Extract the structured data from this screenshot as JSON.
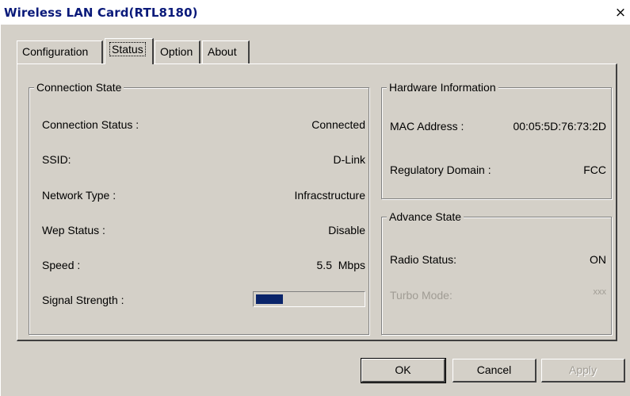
{
  "window": {
    "title": "Wireless LAN Card(RTL8180)",
    "close_glyph": "×"
  },
  "tabs": [
    {
      "label": "Configuration",
      "active": false
    },
    {
      "label": "Status",
      "active": true
    },
    {
      "label": "Option",
      "active": false
    },
    {
      "label": "About",
      "active": false
    }
  ],
  "connection_state": {
    "title": "Connection State",
    "rows": [
      {
        "label": "Connection Status :",
        "value": "Connected"
      },
      {
        "label": "SSID:",
        "value": "D-Link"
      },
      {
        "label": "Network Type :",
        "value": "Infracstructure"
      },
      {
        "label": "Wep Status :",
        "value": "Disable"
      },
      {
        "label": "Speed :",
        "value": "5.5  Mbps"
      },
      {
        "label": "Signal Strength :",
        "value": ""
      }
    ],
    "signal_strength_fraction": 0.25
  },
  "hardware_info": {
    "title": "Hardware Information",
    "mac_label": "MAC Address :",
    "mac_value": "00:05:5D:76:73:2D",
    "domain_label": "Regulatory Domain :",
    "domain_value": "FCC"
  },
  "advance_state": {
    "title": "Advance State",
    "radio_label": "Radio Status:",
    "radio_value": "ON",
    "turbo_label": "Turbo Mode:",
    "turbo_value": "xxx"
  },
  "buttons": {
    "ok": "OK",
    "cancel": "Cancel",
    "apply": "Apply"
  },
  "colors": {
    "dialog_face": "#d4d0c8",
    "title_text": "#0a1a7a",
    "progress_fill": "#0a246a",
    "disabled_text": "#a09c94"
  }
}
